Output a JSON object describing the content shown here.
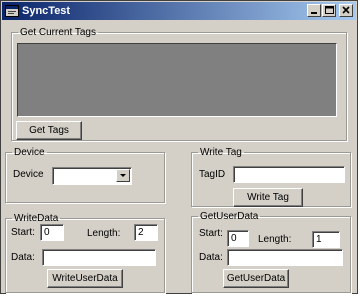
{
  "window": {
    "title": "SyncTest",
    "icon": "app-form-icon",
    "controls": [
      "minimize-icon",
      "maximize-icon",
      "close-icon"
    ]
  },
  "get_current_tags": {
    "legend": "Get Current Tags",
    "button_label": "Get Tags"
  },
  "device": {
    "legend": "Device",
    "label": "Device",
    "selected_value": ""
  },
  "write_tag": {
    "legend": "Write Tag",
    "tagid_label": "TagID",
    "tagid_value": "",
    "button_label": "Write Tag"
  },
  "write_data": {
    "legend": "WriteData",
    "start_label": "Start:",
    "start_value": "0",
    "length_label": "Length:",
    "length_value": "2",
    "data_label": "Data:",
    "data_value": "",
    "button_label": "WriteUserData"
  },
  "get_user_data": {
    "legend": "GetUserData",
    "start_label": "Start:",
    "start_value": "0",
    "length_label": "Length:",
    "length_value": "1",
    "data_label": "Data:",
    "data_value": "",
    "button_label": "GetUserData"
  },
  "colors": {
    "title_gradient_start": "#0a246a",
    "title_gradient_end": "#a6caf0",
    "face": "#d4d0c8",
    "listbox_bg": "#808080"
  }
}
